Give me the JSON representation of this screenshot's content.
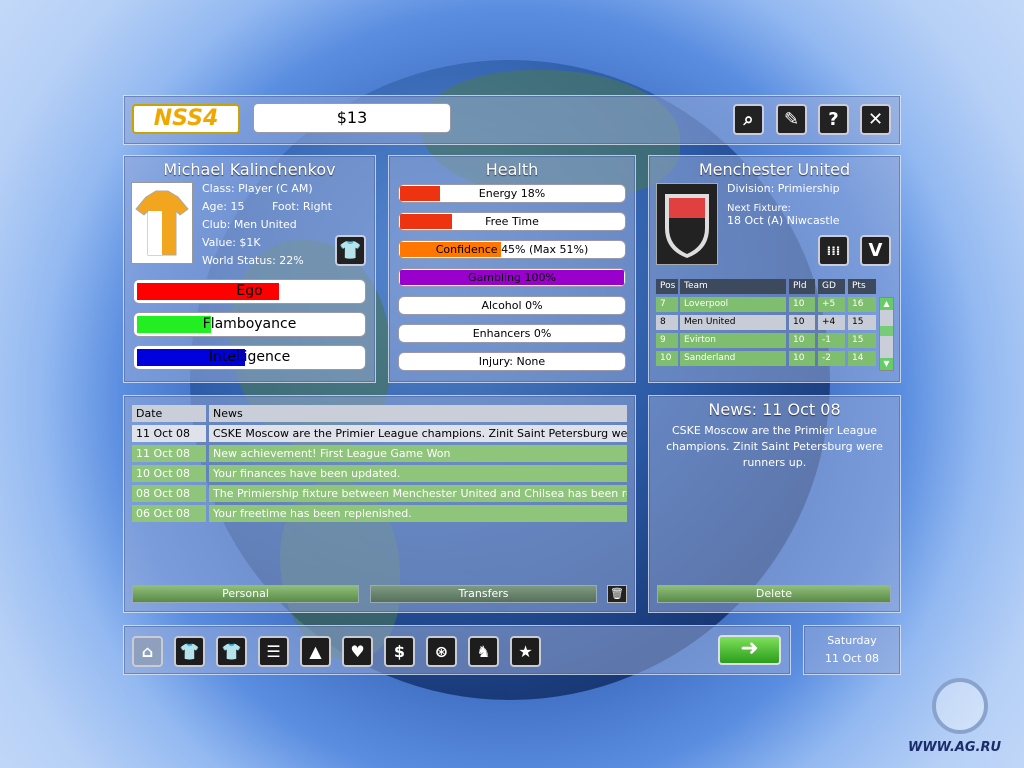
{
  "money": "$13",
  "player": {
    "name": "Michael Kalinchenkov",
    "class": "Class: Player (C AM)",
    "age": "Age: 15",
    "foot": "Foot: Right",
    "club": "Club: Men United",
    "value": "Value: $1K",
    "world": "World Status: 22%",
    "traits": [
      {
        "label": "Ego",
        "level": 0.63,
        "color": "#ff0000"
      },
      {
        "label": "Flamboyance",
        "level": 0.33,
        "color": "#22ee22"
      },
      {
        "label": "Intelligence",
        "level": 0.48,
        "color": "#0000dd"
      }
    ]
  },
  "health": {
    "title": "Health",
    "bars": [
      {
        "label": "Energy 18%",
        "level": 0.18,
        "color": "#ee3311"
      },
      {
        "label": "Free Time",
        "level": 0.23,
        "color": "#ee3311"
      },
      {
        "label": "Confidence 45% (Max 51%)",
        "level": 0.45,
        "color": "#ff7700"
      },
      {
        "label": "Gambling 100%",
        "level": 1.0,
        "color": "#9900cc"
      },
      {
        "label": "Alcohol 0%",
        "level": 0,
        "color": "#ffffff"
      },
      {
        "label": "Enhancers 0%",
        "level": 0,
        "color": "#ffffff"
      },
      {
        "label": "Injury: None",
        "level": 0,
        "color": "#ffffff"
      }
    ]
  },
  "club": {
    "name": "Menchester United",
    "division": "Division: Primiership",
    "next_label": "Next Fixture:",
    "next": "18 Oct (A) Niwcastle",
    "v_label": "V",
    "table_headers": [
      "Pos",
      "Team",
      "Pld",
      "GD",
      "Pts"
    ],
    "rows": [
      [
        "7",
        "Loverpool",
        "10",
        "+5",
        "16"
      ],
      [
        "8",
        "Men United",
        "10",
        "+4",
        "15"
      ],
      [
        "9",
        "Evirton",
        "10",
        "-1",
        "15"
      ],
      [
        "10",
        "Sanderland",
        "10",
        "-2",
        "14"
      ]
    ]
  },
  "newslist": {
    "headers": [
      "Date",
      "News"
    ],
    "rows": [
      [
        "11 Oct 08",
        "CSKE Moscow are the Primier League champions. Zinit Saint Petersburg were"
      ],
      [
        "11 Oct 08",
        "New achievement! First League Game Won"
      ],
      [
        "10 Oct 08",
        "Your finances have been updated."
      ],
      [
        "08 Oct 08",
        "The Primiership fixture between Menchester United and Chilsea has been re"
      ],
      [
        "06 Oct 08",
        "Your freetime has been replenished."
      ]
    ],
    "personal": "Personal",
    "transfers": "Transfers"
  },
  "detail": {
    "title": "News: 11 Oct 08",
    "body": "CSKE Moscow are the Primier League champions. Zinit Saint Petersburg were runners up.",
    "delete": "Delete"
  },
  "date": {
    "day": "Saturday",
    "date": "11 Oct 08"
  },
  "logo": "NSS4",
  "watermark": "WWW.AG.RU"
}
